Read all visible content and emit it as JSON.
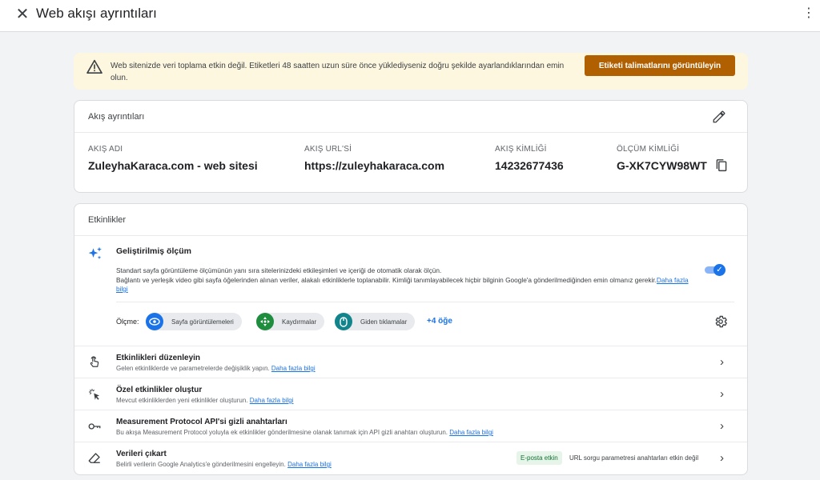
{
  "header": {
    "title": "Web akışı ayrıntıları",
    "close_glyph": "✕",
    "menu_glyph": "⋮"
  },
  "banner": {
    "message": "Web sitenizde veri toplama etkin değil. Etiketleri 48 saatten uzun süre önce yüklediyseniz doğru şekilde ayarlandıklarından emin olun.",
    "button_label": "Etiketi talimatlarını görüntüleyin",
    "icon": "warning-icon",
    "bg_color": "#fef7e0",
    "button_color": "#b06000"
  },
  "stream_details": {
    "heading": "Akış ayrıntıları",
    "fields": [
      {
        "label": "AKIŞ ADI",
        "value": "ZuleyhaKaraca.com - web sitesi"
      },
      {
        "label": "AKIŞ URL'Sİ",
        "value": "https://zuleyhakaraca.com"
      },
      {
        "label": "AKIŞ KİMLİĞİ",
        "value": "14232677436"
      },
      {
        "label": "ÖLÇÜM KİMLİĞİ",
        "value": "G-XK7CYW98WT"
      }
    ]
  },
  "events": {
    "heading": "Etkinlikler",
    "enhanced": {
      "title": "Geliştirilmiş ölçüm",
      "desc_line1": "Standart sayfa görüntüleme ölçümünün yanı sıra sitelerinizdeki etkileşimleri ve içeriği de otomatik olarak ölçün.",
      "desc_line2": "Bağlantı ve yerleşik video gibi sayfa öğelerinden alınan veriler, alakalı etkinliklerle toplanabilir. Kimliği tanımlayabilecek hiçbir bilginin Google'a gönderilmediğinden emin olmanız gerekir.",
      "learn_more": "Daha fazla bilgi",
      "toggle_on": true,
      "measuring_label": "Ölçme:",
      "chips": [
        {
          "label": "Sayfa görüntülemeleri",
          "icon": "eye-icon",
          "color": "#1a73e8"
        },
        {
          "label": "Kaydırmalar",
          "icon": "scroll-arrows-icon",
          "color": "#1e8e3e"
        },
        {
          "label": "Giden tıklamalar",
          "icon": "mouse-icon",
          "color": "#12848c"
        }
      ],
      "more_label": "+4 öğe"
    },
    "rows": [
      {
        "title": "Etkinlikleri düzenleyin",
        "desc": "Gelen etkinliklerde ve parametrelerde değişiklik yapın.",
        "link": "Daha fazla bilgi",
        "icon": "touch-icon"
      },
      {
        "title": "Özel etkinlikler oluştur",
        "desc": "Mevcut etkinliklerden yeni etkinlikler oluşturun.",
        "link": "Daha fazla bilgi",
        "icon": "sparkle-click-icon"
      },
      {
        "title": "Measurement Protocol API'si gizli anahtarları",
        "desc": "Bu akışa Measurement Protocol yoluyla ek etkinlikler gönderilmesine olanak tanımak için API gizli anahtarı oluşturun.",
        "link": "Daha fazla bilgi",
        "icon": "key-icon"
      },
      {
        "title": "Verileri çıkart",
        "desc": "Belirli verilerin Google Analytics'e gönderilmesini engelleyin.",
        "link": "Daha fazla bilgi",
        "icon": "eraser-icon",
        "badge": "E-posta etkin",
        "status": "URL sorgu parametresi anahtarları etkin değil"
      }
    ]
  }
}
